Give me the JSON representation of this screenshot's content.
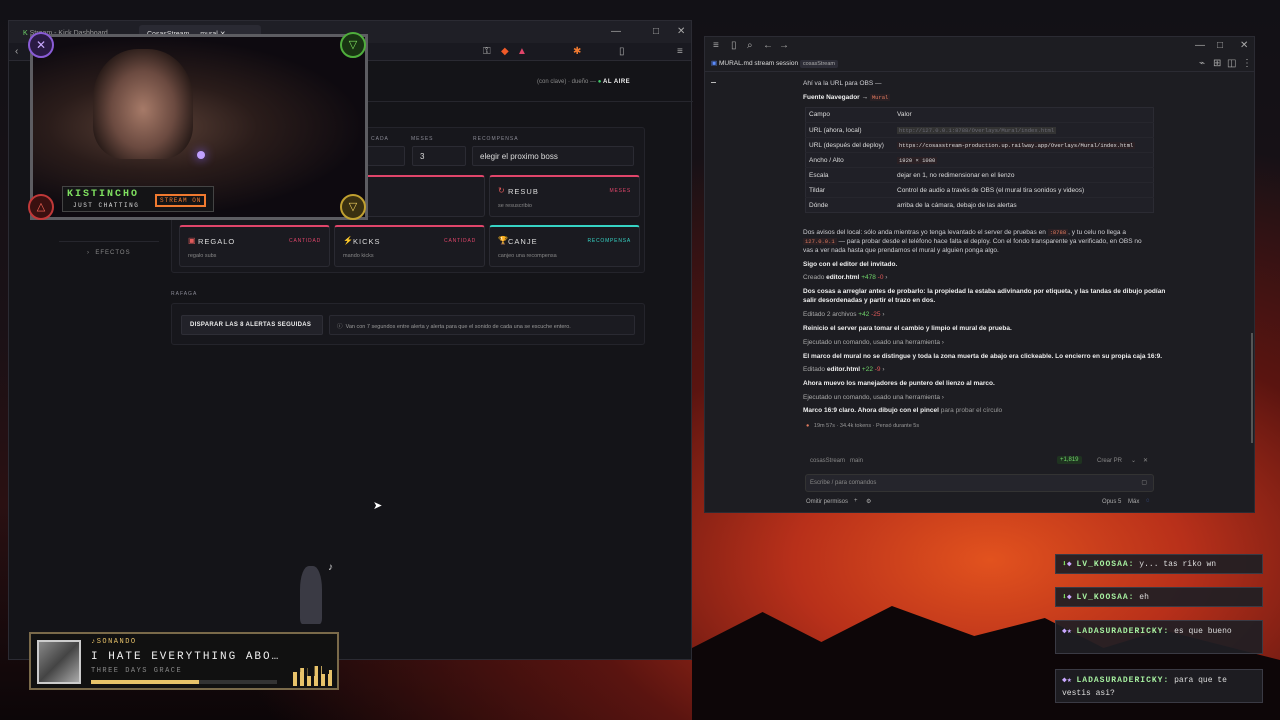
{
  "browser": {
    "tabs": [
      "Stream - Kick Dashboard",
      "CosasStream — mural"
    ],
    "status_hint": "(con clave) · dueño —",
    "live_label": "AL AIRE"
  },
  "form": {
    "label_cada": "CADA",
    "label_meses": "MESES",
    "label_recompensa": "RECOMPENSA",
    "meses_value": "3",
    "recompensa_value": "elegir el proximo boss"
  },
  "cards": [
    {
      "title": "RESUB",
      "tag": "MESES",
      "desc": "se resuscribio",
      "tag_color": "#e0456a"
    },
    {
      "title": "REGALO",
      "tag": "CANTIDAD",
      "desc": "regalo subs",
      "tag_color": "#e0456a"
    },
    {
      "title": "KICKS",
      "tag": "CANTIDAD",
      "desc": "mando kicks",
      "tag_color": "#e0456a"
    },
    {
      "title": "CANJE",
      "tag": "RECOMPENSA",
      "desc": "canjeo una recompensa",
      "tag_color": "#36d3c4"
    }
  ],
  "sidebar": {
    "efectos": "EFECTOS"
  },
  "rafaga": {
    "section": "RAFAGA",
    "button": "DISPARAR LAS 8 ALERTAS SEGUIDAS",
    "info": "Van con 7 segundos entre alerta y alerta para que el sonido de cada una se escuche entero."
  },
  "webcam": {
    "name": "KISTINCHO",
    "sub": "JUST CHATTING",
    "badge": "STREAM ON"
  },
  "music": {
    "status": "SONANDO",
    "title": "I HATE EVERYTHING ABO…",
    "artist": "THREE DAYS GRACE",
    "progress": 0.58
  },
  "session": {
    "tab_title": "MURAL.md stream session",
    "tab_chip": "cosasStream",
    "line_url": "Ahí va la URL para OBS —",
    "fuente": "Fuente Navegador",
    "fuente_chip": "Mural",
    "table_headers": [
      "Campo",
      "Valor"
    ],
    "table_rows": [
      [
        "URL (ahora, local)",
        "http://127.0.0.1:8788/Overlays/Mural/index.html"
      ],
      [
        "URL (después del deploy)",
        "https://cosasstream-production.up.railway.app/Overlays/Mural/index.html"
      ],
      [
        "Ancho / Alto",
        "1920 × 1080"
      ],
      [
        "Escala",
        "dejar en 1, no redimensionar en el lienzo"
      ],
      [
        "Tildar",
        "Control de audio a través de OBS (el mural tira sonidos y videos)"
      ],
      [
        "Dónde",
        "arriba de la cámara, debajo de las alertas"
      ]
    ],
    "para1_a": "Dos avisos del local: sólo anda mientras yo tenga levantado el server de pruebas en",
    "para1_code": ":8788",
    "para1_b": ", y tu celu no llega a",
    "para1_c_code": "127.0.0.1",
    "para1_c": "— para probar desde el teléfono hace falta el deploy. Con el fondo transparente ya verificado, en OBS no",
    "para1_d": "vas a ver nada hasta que prendamos el mural y alguien ponga algo.",
    "l_editor": "Sigo con el editor del invitado.",
    "l_creado": "Creado",
    "l_creado_file": "editor.html",
    "l_creado_add": "+478",
    "l_creado_del": "-0",
    "para2_a": "Dos cosas a arreglar antes de probarlo: la propiedad la estaba adivinando por etiqueta, y las tandas de dibujo podían",
    "para2_b": "salir desordenadas y partir el trazo en dos.",
    "l_edit2": "Editado 2 archivos",
    "l_edit2_add": "+42",
    "l_edit2_del": "-25",
    "l_reinicio": "Reinicio el server para tomar el cambio y limpio el mural de prueba.",
    "l_ejecutado": "Ejecutado un comando, usado una herramienta",
    "l_marco": "El marco del mural no se distingue y toda la zona muerta de abajo era clickeable. Lo encierro en su propia caja 16:9.",
    "l_edit3": "Editado",
    "l_edit3_file": "editor.html",
    "l_edit3_add": "+22",
    "l_edit3_del": "-9",
    "l_mueve": "Ahora muevo los manejadores de puntero del lienzo al marco.",
    "l_ejecutado2": "Ejecutado un comando, usado una herramienta",
    "l_marco2_a": "Marco 16:9 claro. Ahora dibujo con el pincel",
    "l_marco2_b": "para probar el círculo",
    "l_stats": "19m 57s · 34.4k tokens · Pensó durante 5s",
    "branch_repo": "cosasStream",
    "branch": "main",
    "diff": "+1,819",
    "crear_pr": "Crear PR",
    "input_placeholder": "Escribe / para comandos",
    "omitir": "Omitir permisos",
    "model": "Opus 5",
    "effort": "Máx"
  },
  "chat": [
    {
      "user": "LV_KOOSAA:",
      "msg": "y... tas riko wn"
    },
    {
      "user": "LV_KOOSAA:",
      "msg": "eh"
    },
    {
      "user": "LADASURADERICKY:",
      "msg": "es que bueno"
    },
    {
      "user": "LADASURADERICKY:",
      "msg": "para que te vestis asi?"
    }
  ]
}
